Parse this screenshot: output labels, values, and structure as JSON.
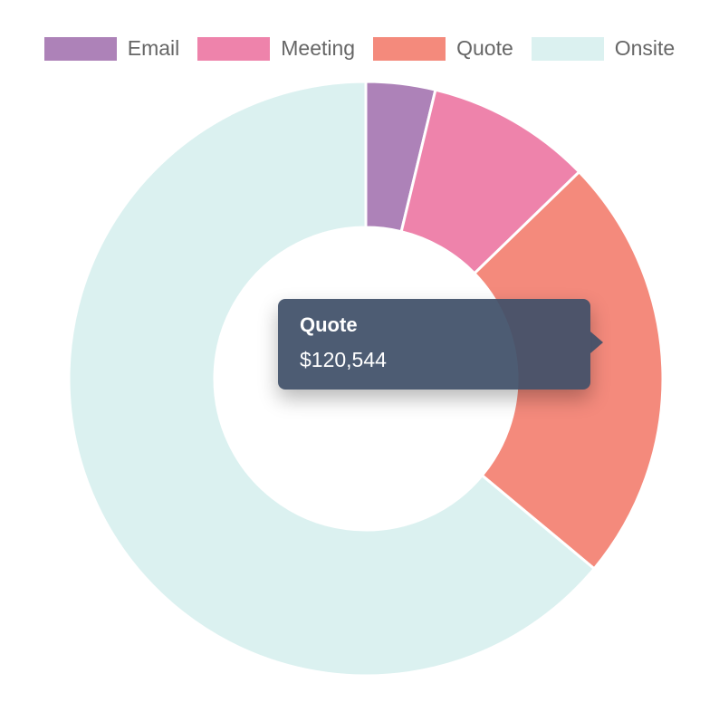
{
  "chart_data": {
    "type": "pie",
    "variant": "doughnut",
    "categories": [
      "Email",
      "Meeting",
      "Quote",
      "Onsite"
    ],
    "values": [
      19500,
      46500,
      120544,
      331000
    ],
    "colors": [
      "#ad82b8",
      "#ee83ab",
      "#f48a7c",
      "#dbf1f0"
    ],
    "legend_position": "top"
  },
  "tooltip": {
    "title": "Quote",
    "value": "$120,544"
  }
}
